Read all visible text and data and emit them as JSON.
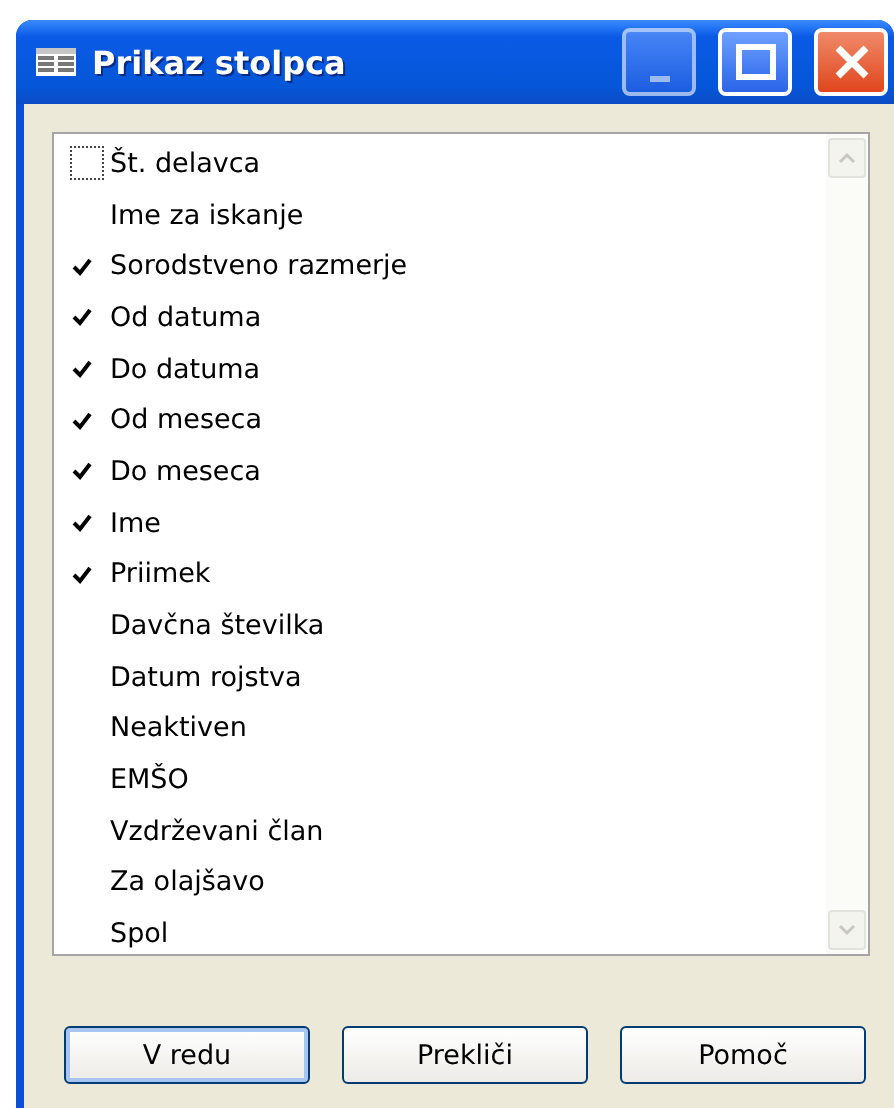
{
  "window": {
    "title": "Prikaz stolpca"
  },
  "columns": [
    {
      "label": "Št. delavca",
      "checked": false,
      "focused": true
    },
    {
      "label": "Ime za iskanje",
      "checked": false,
      "focused": false
    },
    {
      "label": "Sorodstveno razmerje",
      "checked": true,
      "focused": false
    },
    {
      "label": "Od datuma",
      "checked": true,
      "focused": false
    },
    {
      "label": "Do datuma",
      "checked": true,
      "focused": false
    },
    {
      "label": "Od meseca",
      "checked": true,
      "focused": false
    },
    {
      "label": "Do meseca",
      "checked": true,
      "focused": false
    },
    {
      "label": "Ime",
      "checked": true,
      "focused": false
    },
    {
      "label": "Priimek",
      "checked": true,
      "focused": false
    },
    {
      "label": "Davčna številka",
      "checked": false,
      "focused": false
    },
    {
      "label": "Datum rojstva",
      "checked": false,
      "focused": false
    },
    {
      "label": "Neaktiven",
      "checked": false,
      "focused": false
    },
    {
      "label": "EMŠO",
      "checked": false,
      "focused": false
    },
    {
      "label": "Vzdrževani član",
      "checked": false,
      "focused": false
    },
    {
      "label": "Za olajšavo",
      "checked": false,
      "focused": false
    },
    {
      "label": "Spol",
      "checked": false,
      "focused": false
    }
  ],
  "buttons": [
    {
      "label": "V redu",
      "selected": true
    },
    {
      "label": "Prekliči",
      "selected": false
    },
    {
      "label": "Pomoč",
      "selected": false
    }
  ]
}
